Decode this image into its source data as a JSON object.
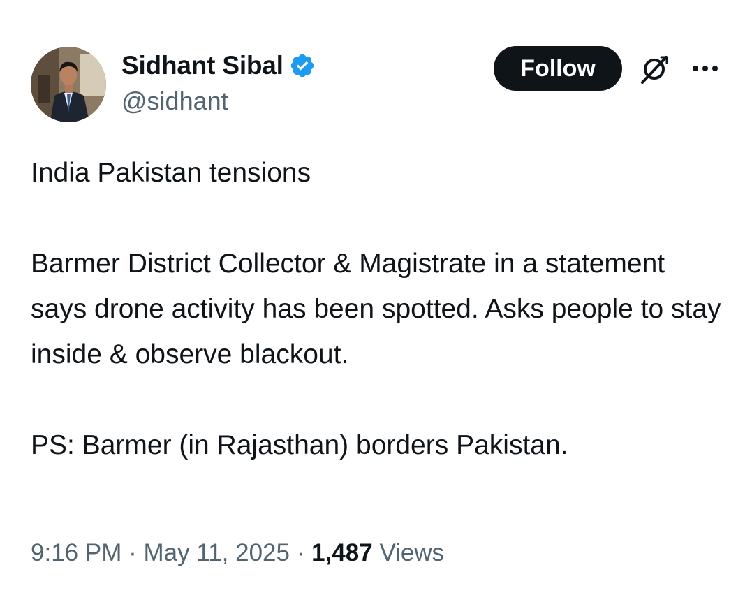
{
  "author": {
    "display_name": "Sidhant Sibal",
    "handle": "@sidhant",
    "verified": true,
    "verified_color": "#1d9bf0"
  },
  "actions": {
    "follow_label": "Follow",
    "grok_icon": "grok-icon",
    "more_icon": "more-options-icon"
  },
  "tweet": {
    "paragraphs": [
      "India Pakistan tensions",
      "Barmer District Collector & Magistrate in a statement says drone activity has been spotted. Asks people to stay inside & observe blackout.",
      "PS: Barmer (in Rajasthan) borders Pakistan."
    ]
  },
  "meta": {
    "time": "9:16 PM",
    "separator": "·",
    "date": "May 11, 2025",
    "views_count": "1,487",
    "views_label": "Views"
  },
  "colors": {
    "text_primary": "#0f1419",
    "text_secondary": "#536471",
    "button_bg": "#0f1419",
    "button_text": "#ffffff"
  }
}
